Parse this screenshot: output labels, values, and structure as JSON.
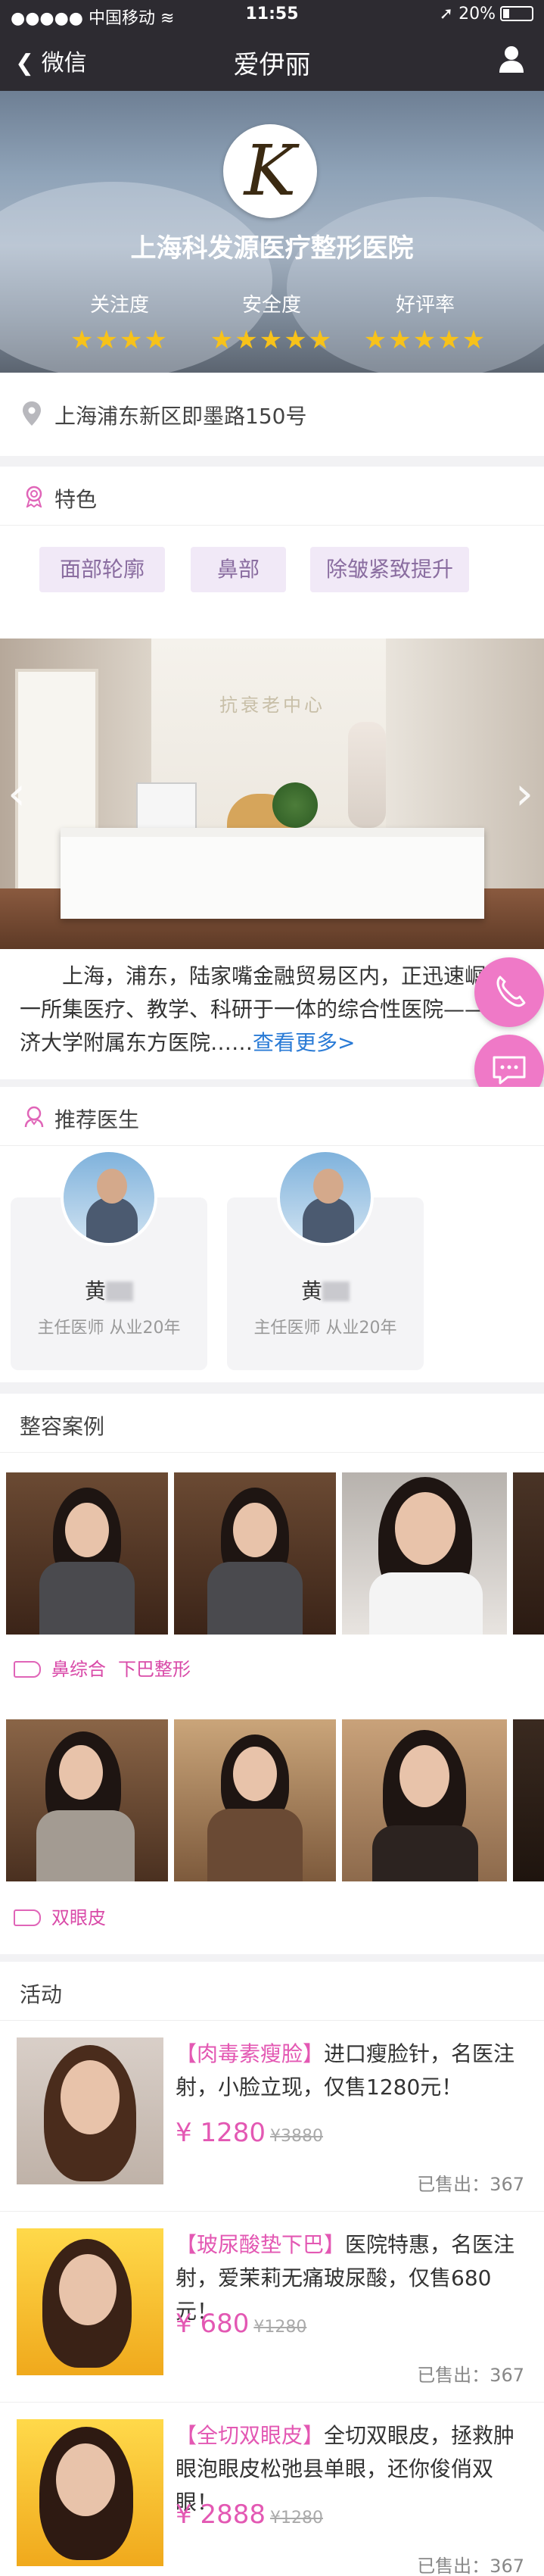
{
  "status": {
    "carrier": "中国移动",
    "time": "11:55",
    "battery": "20%"
  },
  "nav": {
    "back_label": "微信",
    "title": "爱伊丽"
  },
  "hero": {
    "logo_letter": "K",
    "hospital_name": "上海科发源医疗整形医院",
    "metrics": [
      {
        "label": "关注度",
        "stars": 4
      },
      {
        "label": "安全度",
        "stars": 5
      },
      {
        "label": "好评率",
        "stars": 5
      }
    ]
  },
  "address": "上海浦东新区即墨路150号",
  "features": {
    "title": "特色",
    "tags": [
      "面部轮廓",
      "鼻部",
      "除皱紧致提升"
    ]
  },
  "clinic_sign": "抗衰老中心",
  "intro": {
    "text": "上海，浦东，陆家嘴金融贸易区内，正迅速崛起一所集医疗、教学、科研于一体的综合性医院——同济大学附属东方医院……",
    "more": "查看更多>"
  },
  "doctors": {
    "title": "推荐医生",
    "items": [
      {
        "surname": "黄",
        "info": "主任医师 从业20年"
      },
      {
        "surname": "黄",
        "info": "主任医师 从业20年"
      }
    ]
  },
  "cases": {
    "title": "整容案例",
    "groups": [
      {
        "tags": [
          "鼻综合",
          "下巴整形"
        ]
      },
      {
        "tags": [
          "双眼皮"
        ]
      }
    ]
  },
  "activities": {
    "title": "活动",
    "items": [
      {
        "highlight": "【肉毒素瘦脸】",
        "text": "进口瘦脸针，名医注射，小脸立现，仅售1280元！",
        "price": "¥ 1280",
        "original": "¥3880",
        "sold": "已售出：367"
      },
      {
        "highlight": "【玻尿酸垫下巴】",
        "text": "医院特惠，名医注射，爱茉莉无痛玻尿酸，仅售680元！",
        "price": "¥ 680",
        "original": "¥1280",
        "sold": "已售出：367"
      },
      {
        "highlight": "【全切双眼皮】",
        "text": "全切双眼皮，拯救肿眼泡眼皮松弛县单眼，还你俊俏双眼！",
        "price": "¥ 2888",
        "original": "¥1280",
        "sold": "已售出：367"
      }
    ]
  },
  "colors": {
    "nav": "#2d2b31",
    "accent": "#e358b3",
    "star": "#f7c21a",
    "tag_bg": "#f1e9f7",
    "link": "#2a7bd6"
  }
}
